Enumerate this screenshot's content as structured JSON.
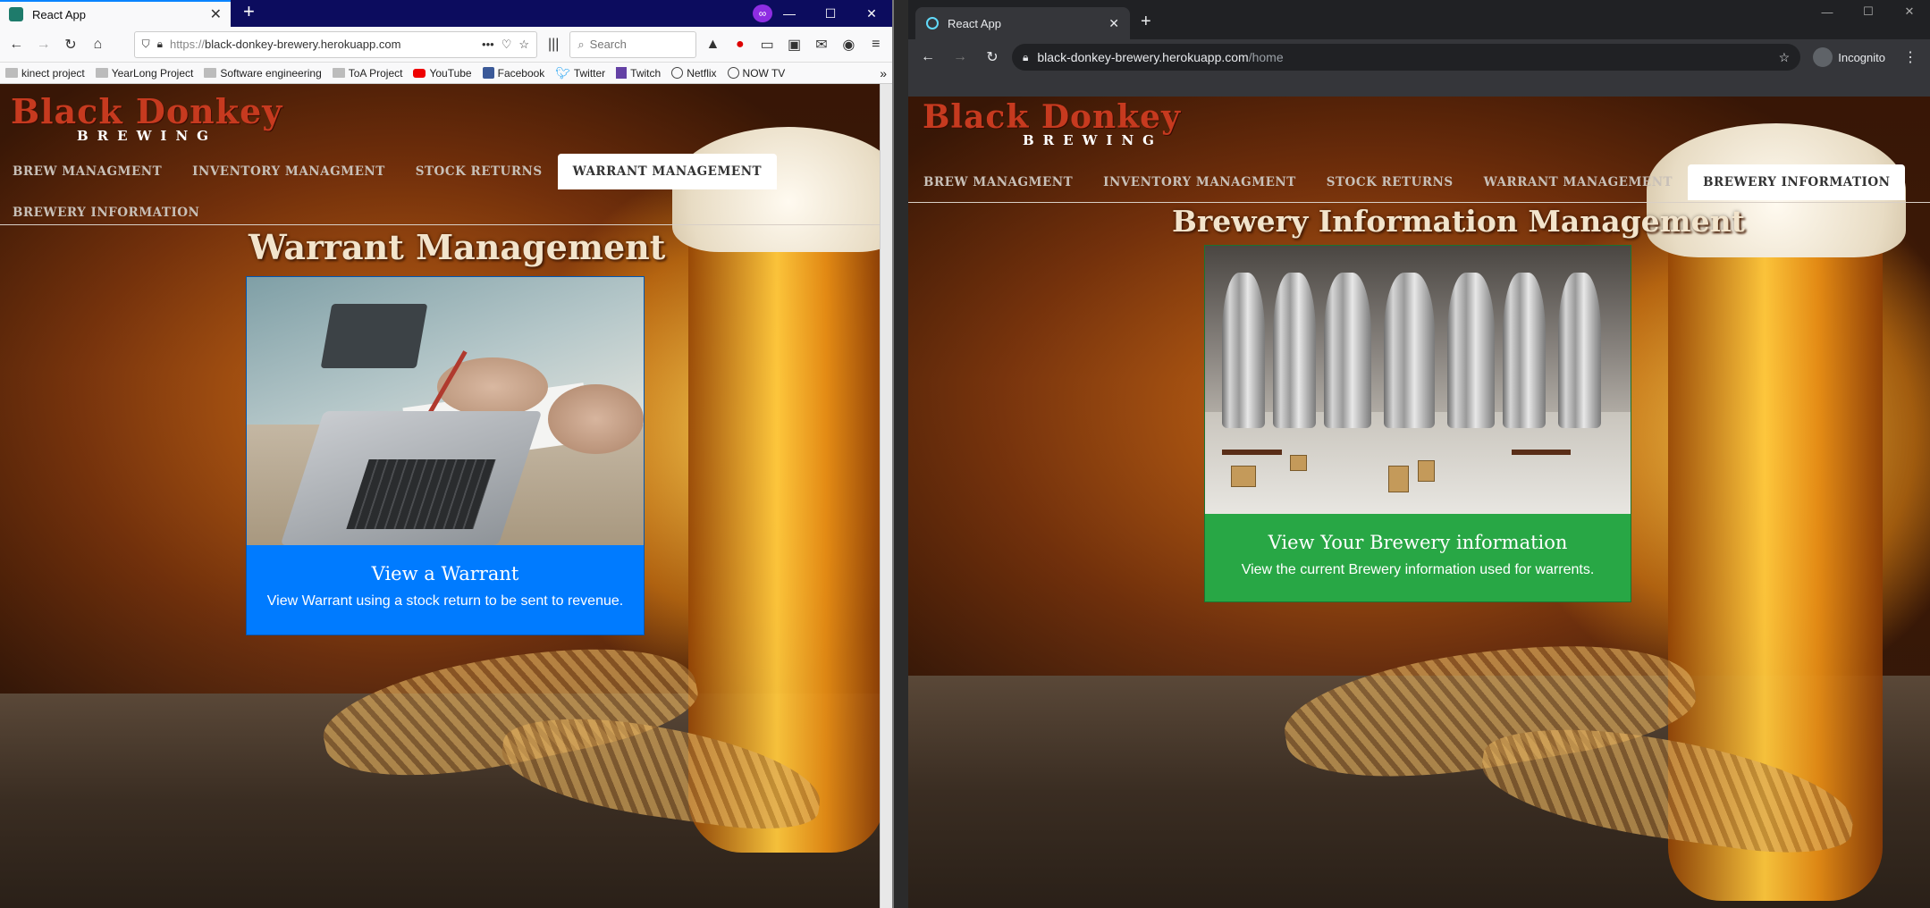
{
  "left_browser": {
    "tab_title": "React App",
    "url_prefix": "https://",
    "url_main": "black-donkey-brewery.herokuapp.com",
    "url_rest": "",
    "search_placeholder": "Search",
    "bookmarks": [
      {
        "label": "kinect project",
        "icon": "folder"
      },
      {
        "label": "YearLong Project",
        "icon": "folder"
      },
      {
        "label": "Software engineering",
        "icon": "folder"
      },
      {
        "label": "ToA Project",
        "icon": "folder"
      },
      {
        "label": "YouTube",
        "icon": "youtube-icon"
      },
      {
        "label": "Facebook",
        "icon": "facebook-icon"
      },
      {
        "label": "Twitter",
        "icon": "twitter-icon"
      },
      {
        "label": "Twitch",
        "icon": "twitch-icon"
      },
      {
        "label": "Netflix",
        "icon": "globe-icon"
      },
      {
        "label": "NOW TV",
        "icon": "globe-icon"
      }
    ]
  },
  "right_browser": {
    "tab_title": "React App",
    "url_main": "black-donkey-brewery.herokuapp.com",
    "url_path": "/home",
    "profile_label": "Incognito"
  },
  "site": {
    "logo_line1": "Black Donkey",
    "logo_line2": "BREWING",
    "nav": [
      "BREW MANAGMENT",
      "INVENTORY MANAGMENT",
      "STOCK RETURNS",
      "WARRANT MANAGEMENT",
      "BREWERY INFORMATION"
    ]
  },
  "left_page": {
    "active_nav": "WARRANT MANAGEMENT",
    "title": "Warrant Management",
    "card": {
      "heading": "View a Warrant",
      "text": "View Warrant using a stock return to be sent to revenue.",
      "color": "#007bff"
    }
  },
  "right_page": {
    "active_nav": "BREWERY INFORMATION",
    "title": "Brewery Information Management",
    "card": {
      "heading": "View Your Brewery information",
      "text": "View the current Brewery information used for warrents.",
      "color": "#28a745"
    }
  }
}
